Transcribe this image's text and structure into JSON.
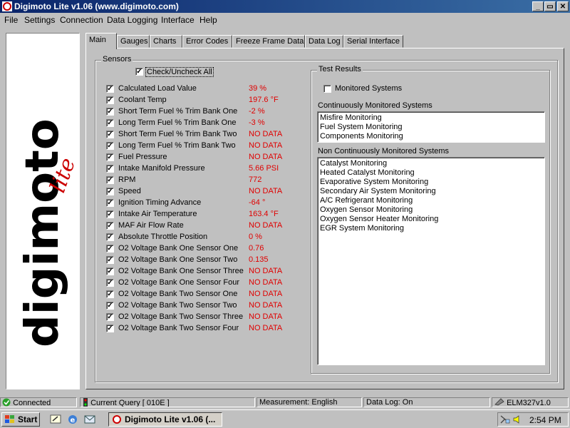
{
  "window": {
    "title": "Digimoto Lite v1.06 (www.digimoto.com)",
    "buttons": [
      "_",
      "▭",
      "✕"
    ]
  },
  "menu": [
    "File",
    "Settings",
    "Connection",
    "Data Logging",
    "Interface",
    "Help"
  ],
  "tabs": [
    "Main",
    "Gauges",
    "Charts",
    "Error Codes",
    "Freeze Frame Data",
    "Data Log",
    "Serial Interface"
  ],
  "active_tab": "Main",
  "sensors": {
    "group_title": "Sensors",
    "check_all_label": "Check/Uncheck All",
    "check_all_checked": true,
    "items": [
      {
        "name": "Calculated Load Value",
        "value": "39 %",
        "checked": true
      },
      {
        "name": "Coolant Temp",
        "value": "197.6 °F",
        "checked": true
      },
      {
        "name": "Short Term Fuel % Trim Bank One",
        "value": "-2 %",
        "checked": true
      },
      {
        "name": "Long Term Fuel % Trim Bank One",
        "value": "-3 %",
        "checked": true
      },
      {
        "name": "Short Term Fuel % Trim Bank Two",
        "value": "NO DATA",
        "checked": true
      },
      {
        "name": "Long Term Fuel % Trim Bank Two",
        "value": "NO DATA",
        "checked": true
      },
      {
        "name": "Fuel Pressure",
        "value": "NO DATA",
        "checked": true
      },
      {
        "name": "Intake Manifold Pressure",
        "value": "5.66 PSI",
        "checked": true
      },
      {
        "name": "RPM",
        "value": "772",
        "checked": true
      },
      {
        "name": "Speed",
        "value": "NO DATA",
        "checked": true
      },
      {
        "name": "Ignition Timing Advance",
        "value": "-64 °",
        "checked": true
      },
      {
        "name": "Intake Air Temperature",
        "value": "163.4 °F",
        "checked": true
      },
      {
        "name": "MAF Air Flow Rate",
        "value": "NO DATA",
        "checked": true
      },
      {
        "name": "Absolute Throttle Position",
        "value": "0 %",
        "checked": true
      },
      {
        "name": "O2 Voltage Bank One Sensor One",
        "value": "0.76",
        "checked": true
      },
      {
        "name": "O2 Voltage Bank One Sensor Two",
        "value": "0.135",
        "checked": true
      },
      {
        "name": "O2 Voltage Bank One Sensor Three",
        "value": "NO DATA",
        "checked": true
      },
      {
        "name": "O2 Voltage Bank One Sensor Four",
        "value": "NO DATA",
        "checked": true
      },
      {
        "name": "O2 Voltage Bank Two Sensor One",
        "value": "NO DATA",
        "checked": true
      },
      {
        "name": "O2 Voltage Bank Two Sensor Two",
        "value": "NO DATA",
        "checked": true
      },
      {
        "name": "O2 Voltage Bank Two Sensor Three",
        "value": "NO DATA",
        "checked": true
      },
      {
        "name": "O2 Voltage Bank Two Sensor Four",
        "value": "NO DATA",
        "checked": true
      }
    ]
  },
  "test_results": {
    "group_title": "Test Results",
    "monitored_label": "Monitored Systems",
    "monitored_checked": false,
    "continuous_title": "Continuously Monitored Systems",
    "continuous": [
      "Misfire Monitoring",
      "Fuel System Monitoring",
      "Components Monitoring"
    ],
    "noncontinuous_title": "Non Continuously Monitored Systems",
    "noncontinuous": [
      "Catalyst Monitoring",
      "Heated Catalyst Monitoring",
      "Evaporative System Monitoring",
      "Secondary Air System Monitoring",
      "A/C Refrigerant Monitoring",
      "Oxygen Sensor Monitoring",
      "Oxygen Sensor Heater Monitoring",
      "EGR System Monitoring"
    ]
  },
  "logo_text": "digimoto",
  "logo_sub": "lite",
  "status": {
    "connected": "Connected",
    "query": "Current Query [ 010E ]",
    "measurement": "Measurement: English",
    "datalog": "Data Log: On",
    "device": "ELM327v1.0"
  },
  "taskbar": {
    "start": "Start",
    "task": "Digimoto Lite v1.06 (...",
    "clock": "2:54 PM"
  },
  "colors": {
    "title_start": "#0a246a",
    "title_end": "#3a6ea5",
    "value_red": "#e00000",
    "logo_red": "#cc0000"
  }
}
